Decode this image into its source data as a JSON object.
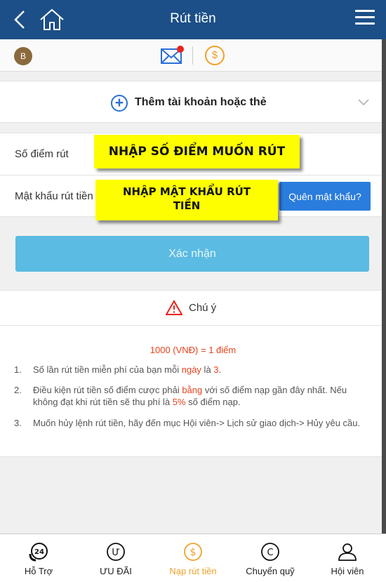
{
  "header": {
    "title": "Rút tiền"
  },
  "subbar": {
    "avatar_letter": "B",
    "coin_symbol": "$"
  },
  "add_account": {
    "label": "Thêm tài khoản hoặc thẻ"
  },
  "form": {
    "points_label": "Số điểm rút",
    "password_label": "Mật khẩu rút tiền",
    "forgot_label": "Quên mật khẩu?",
    "confirm_label": "Xác nhận"
  },
  "callouts": {
    "points": "NHẬP SỐ ĐIỂM MUỐN RÚT",
    "password_line1": "NHẬP MẬT KHẨU RÚT",
    "password_line2": "TIỀN"
  },
  "note": {
    "title": "Chú ý",
    "rate": "1000 (VNĐ) = 1 điểm",
    "items": [
      {
        "num": "1.",
        "a": "Số lần rút tiền miễn phí của bạn mỗi ",
        "h1": "ngày",
        "b": " là ",
        "h2": "3",
        "c": "."
      },
      {
        "num": "2.",
        "a": "Điều kiện rút tiền số điểm cược phải ",
        "h1": "bằng",
        "b": " với số điểm nạp gần đây nhất. Nếu không đạt khi rút tiền sẽ thu phí là ",
        "h2": "5%",
        "c": " số điểm nạp."
      },
      {
        "num": "3.",
        "a": "Muốn hủy lệnh rút tiền, hãy đến mục Hội viên-> Lịch sử giao dịch-> Hủy yêu cầu."
      }
    ]
  },
  "tabs": [
    {
      "label": "Hỗ Trợ",
      "icon": "support-24-icon",
      "glyph": "24"
    },
    {
      "label": "ƯU ĐÃI",
      "icon": "promo-icon",
      "glyph": "Ư"
    },
    {
      "label": "Nạp rút tiền",
      "icon": "deposit-withdraw-icon",
      "glyph": "$"
    },
    {
      "label": "Chuyển quỹ",
      "icon": "transfer-icon",
      "glyph": "C"
    },
    {
      "label": "Hội viên",
      "icon": "member-icon",
      "glyph": ""
    }
  ],
  "colors": {
    "header": "#1c4f87",
    "accent_orange": "#f0a12a",
    "highlight_red": "#e8431d",
    "confirm": "#5bbbe2",
    "forgot": "#2a7cdd",
    "callout": "#fefe00"
  }
}
